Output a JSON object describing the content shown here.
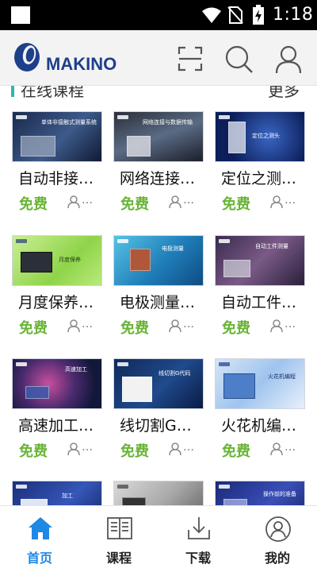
{
  "status_bar": {
    "time": "1:18",
    "icons": [
      "notification-square-icon",
      "wifi-icon",
      "no-sim-icon",
      "battery-charging-icon"
    ]
  },
  "header": {
    "logo_text": "MAKINO",
    "icons": [
      "scan-icon",
      "search-icon",
      "user-icon"
    ]
  },
  "section": {
    "title": "在线课程",
    "more": "更多"
  },
  "courses": [
    {
      "title": "自动非接…",
      "price": "免费",
      "count": "…",
      "thumb_caption": "单体非接触式测量系统"
    },
    {
      "title": "网络连接…",
      "price": "免费",
      "count": "…",
      "thumb_caption": "网络连接与数据传输"
    },
    {
      "title": "定位之测…",
      "price": "免费",
      "count": "…",
      "thumb_caption": "定位之测头"
    },
    {
      "title": "月度保养…",
      "price": "免费",
      "count": "…",
      "thumb_caption": "月度保养"
    },
    {
      "title": "电极测量…",
      "price": "免费",
      "count": "…",
      "thumb_caption": "电极测量"
    },
    {
      "title": "自动工件…",
      "price": "免费",
      "count": "…",
      "thumb_caption": "自动工件测量"
    },
    {
      "title": "高速加工…",
      "price": "免费",
      "count": "…",
      "thumb_caption": "高速加工"
    },
    {
      "title": "线切割G…",
      "price": "免费",
      "count": "…",
      "thumb_caption": "线切割G代码"
    },
    {
      "title": "火花机编…",
      "price": "免费",
      "count": "…",
      "thumb_caption": "火花机编程"
    },
    {
      "title": "",
      "price": "",
      "count": "",
      "thumb_caption": "加工"
    },
    {
      "title": "",
      "price": "",
      "count": "",
      "thumb_caption": ""
    },
    {
      "title": "",
      "price": "",
      "count": "",
      "thumb_caption": "操作前的准备"
    }
  ],
  "nav": [
    {
      "label": "首页",
      "icon": "home-icon",
      "active": true
    },
    {
      "label": "课程",
      "icon": "book-icon",
      "active": false
    },
    {
      "label": "下载",
      "icon": "download-icon",
      "active": false
    },
    {
      "label": "我的",
      "icon": "profile-icon",
      "active": false
    }
  ],
  "colors": {
    "accent_blue": "#1e88e5",
    "free_green": "#68b436",
    "section_bar": "#2cb7b4",
    "logo_blue": "#1e3f8a"
  }
}
